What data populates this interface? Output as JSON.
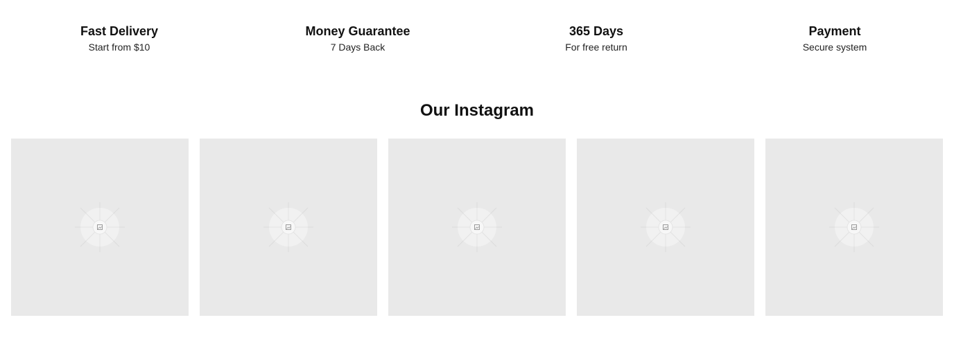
{
  "features": [
    {
      "title": "Fast Delivery",
      "subtitle": "Start from $10"
    },
    {
      "title": "Money Guarantee",
      "subtitle": "7 Days Back"
    },
    {
      "title": "365 Days",
      "subtitle": "For free return"
    },
    {
      "title": "Payment",
      "subtitle": "Secure system"
    }
  ],
  "instagram": {
    "title": "Our Instagram",
    "tiles": [
      {
        "icon": "image-placeholder-icon"
      },
      {
        "icon": "image-placeholder-icon"
      },
      {
        "icon": "image-placeholder-icon"
      },
      {
        "icon": "image-placeholder-icon"
      },
      {
        "icon": "image-placeholder-icon"
      }
    ]
  },
  "colors": {
    "tile_background": "#e9e9e9",
    "text": "#111111"
  }
}
